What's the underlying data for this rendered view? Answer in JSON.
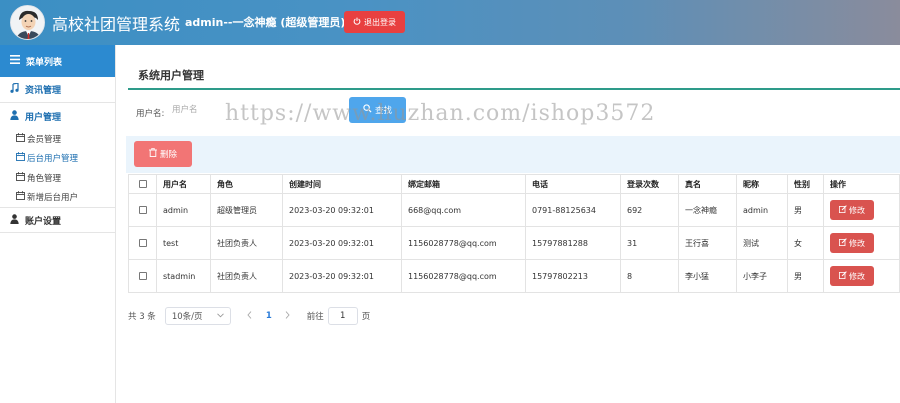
{
  "header": {
    "app_title": "高校社团管理系统",
    "user_info": "admin--一念神瘾 (超级管理员)",
    "logout_label": "退出登录"
  },
  "sidebar": {
    "menu_title": "菜单列表",
    "groups": [
      {
        "label": "资讯管理",
        "icon": "music-note-icon"
      },
      {
        "label": "用户管理",
        "icon": "user-icon"
      },
      {
        "label": "账户设置",
        "icon": "user-icon"
      }
    ],
    "sub_items": [
      {
        "label": "会员管理",
        "icon": "calendar-icon"
      },
      {
        "label": "后台用户管理",
        "icon": "calendar-icon"
      },
      {
        "label": "角色管理",
        "icon": "calendar-icon"
      },
      {
        "label": "新增后台用户",
        "icon": "calendar-icon"
      }
    ]
  },
  "main": {
    "section_title": "系统用户管理",
    "search": {
      "label": "用户名:",
      "placeholder": "用户名",
      "button_label": "查找"
    },
    "delete_label": "删除",
    "table": {
      "headers": [
        "用户名",
        "角色",
        "创建时间",
        "绑定邮箱",
        "电话",
        "登录次数",
        "真名",
        "昵称",
        "性别",
        "操作"
      ],
      "rows": [
        [
          "admin",
          "超级管理员",
          "2023-03-20 09:32:01",
          "668@qq.com",
          "0791-88125634",
          "692",
          "一念神瘾",
          "admin",
          "男"
        ],
        [
          "test",
          "社团负责人",
          "2023-03-20 09:32:01",
          "1156028778@qq.com",
          "15797881288",
          "31",
          "王行喜",
          "测试",
          "女"
        ],
        [
          "stadmin",
          "社团负责人",
          "2023-03-20 09:32:01",
          "1156028778@qq.com",
          "15797802213",
          "8",
          "李小猛",
          "小李子",
          "男"
        ]
      ],
      "edit_label": "修改"
    },
    "pagination": {
      "total": "共 3 条",
      "page_size": "10条/页",
      "current_page": "1",
      "goto_label": "前往",
      "goto_value": "1",
      "page_suffix": "页"
    }
  },
  "watermark": "https://www.huzhan.com/ishop3572",
  "colors": {
    "header_gradient_start": "#3b8fc4",
    "menu_header": "#2c8ad0",
    "logout": "#e84040",
    "search_button": "#4fa6ec",
    "delete_button": "#f27575",
    "edit_button": "#d9534f",
    "title_underline": "#2e9b8a"
  }
}
